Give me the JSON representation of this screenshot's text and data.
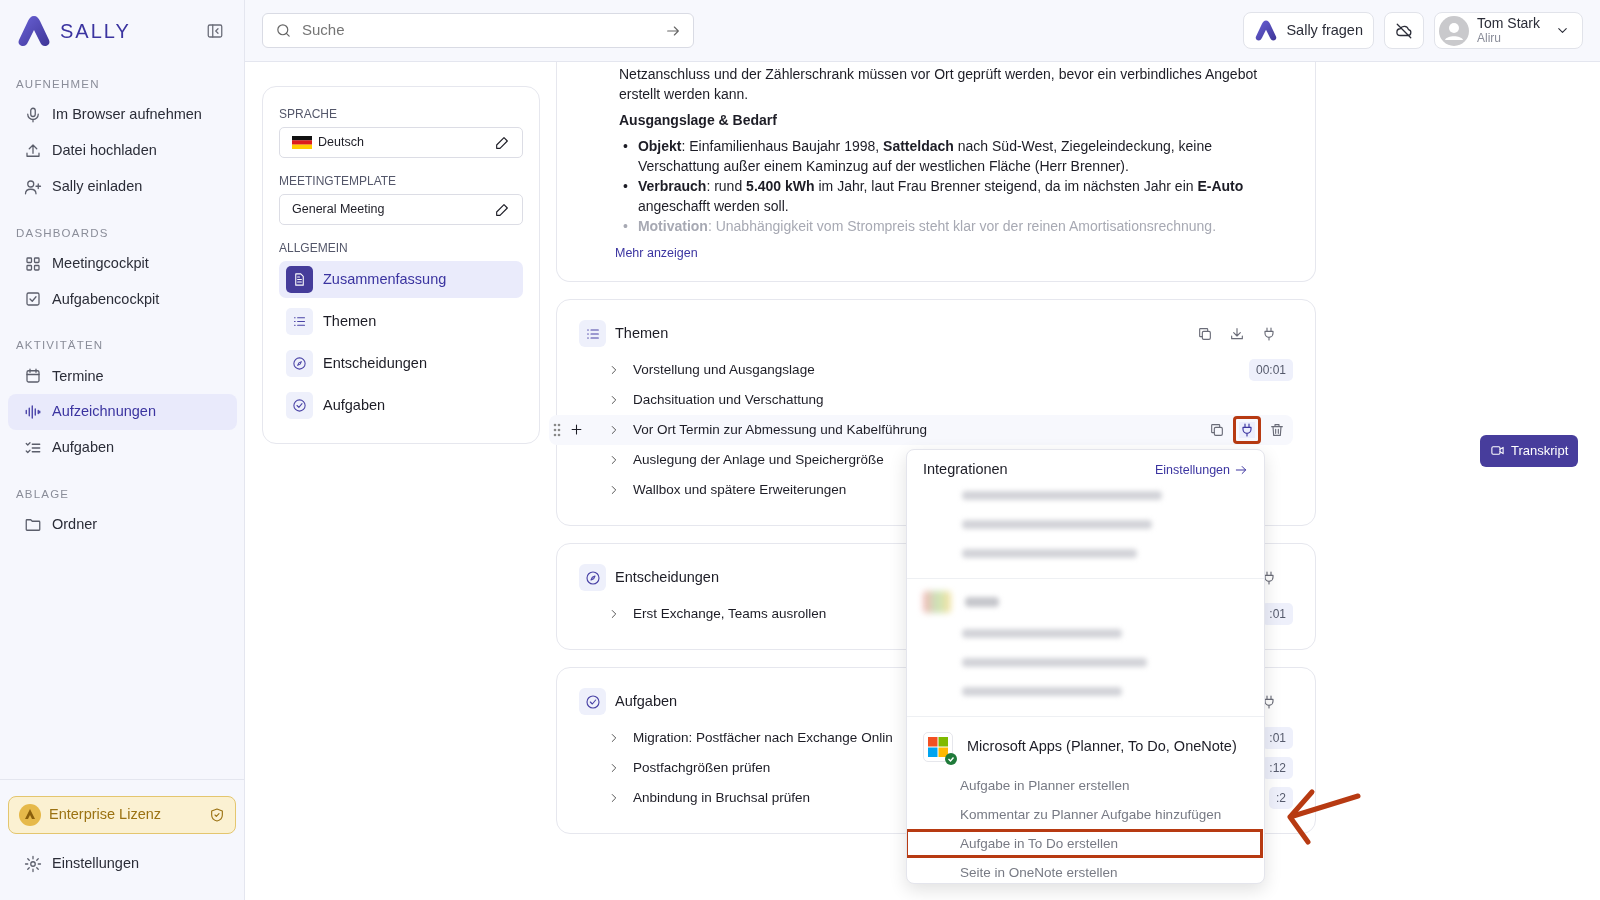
{
  "brand": {
    "name": "SALLY"
  },
  "sidebar": {
    "sections": [
      {
        "title": "AUFNEHMEN",
        "items": [
          {
            "label": "Im Browser aufnehmen",
            "selected": false
          },
          {
            "label": "Datei hochladen",
            "selected": false
          },
          {
            "label": "Sally einladen",
            "selected": false
          }
        ]
      },
      {
        "title": "DASHBOARDS",
        "items": [
          {
            "label": "Meetingcockpit",
            "selected": false
          },
          {
            "label": "Aufgabencockpit",
            "selected": false
          }
        ]
      },
      {
        "title": "AKTIVITÄTEN",
        "items": [
          {
            "label": "Termine",
            "selected": false
          },
          {
            "label": "Aufzeichnungen",
            "selected": true
          },
          {
            "label": "Aufgaben",
            "selected": false
          }
        ]
      },
      {
        "title": "ABLAGE",
        "items": [
          {
            "label": "Ordner",
            "selected": false
          }
        ]
      }
    ],
    "license": {
      "label": "Enterprise Lizenz",
      "verified": true
    },
    "settings": {
      "label": "Einstellungen"
    }
  },
  "search": {
    "placeholder": "Suche"
  },
  "header": {
    "ask_button": "Sally fragen",
    "user": {
      "name": "Tom Stark",
      "org": "Aliru"
    }
  },
  "settings_panel": {
    "language": {
      "label": "SPRACHE",
      "value": "Deutsch"
    },
    "template": {
      "label": "MEETINGTEMPLATE",
      "value": "General Meeting"
    },
    "nav_title": "ALLGEMEIN",
    "nav": [
      {
        "label": "Zusammenfassung",
        "selected": true
      },
      {
        "label": "Themen",
        "selected": false
      },
      {
        "label": "Entscheidungen",
        "selected": false
      },
      {
        "label": "Aufgaben",
        "selected": false
      }
    ]
  },
  "summary": {
    "paragraph": "Netzanschluss und der Zählerschrank müssen vor Ort geprüft werden, bevor ein verbindliches Angebot erstellt werden kann.",
    "heading": "Ausgangslage & Bedarf",
    "bullets": [
      {
        "marker": "•",
        "text": "**Objekt**: Einfamilienhaus Baujahr 1998, **Satteldach** nach Süd-West, Ziegeleindeckung, keine Verschattung außer einem Kaminzug auf der westlichen Fläche (Herr Brenner).",
        "faded": false
      },
      {
        "marker": "•",
        "text": "**Verbrauch**: rund **5.400 kWh** im Jahr, laut Frau Brenner steigend, da im nächsten Jahr ein **E-Auto** angeschafft werden soll.",
        "faded": false
      },
      {
        "marker": "•",
        "text": "**Motivation**: Unabhängigkeit vom Strompreis steht klar vor der reinen Amortisationsrechnung.",
        "faded": true
      }
    ],
    "more_link": "Mehr anzeigen"
  },
  "sections": [
    {
      "title": "Themen",
      "items": [
        {
          "title": "Vorstellung und Ausgangslage",
          "time": "00:01",
          "hovered": false
        },
        {
          "title": "Dachsituation und Verschattung",
          "hovered": false
        },
        {
          "title": "Vor Ort Termin zur Abmessung und Kabelführung",
          "hovered": true,
          "row_actions": [
            {
              "kind": "copy",
              "active": false,
              "annotated": false
            },
            {
              "kind": "plug",
              "active": true,
              "annotated": true
            },
            {
              "kind": "trash",
              "active": false,
              "annotated": false
            }
          ]
        },
        {
          "title": "Auslegung der Anlage und Speichergröße",
          "hovered": false
        },
        {
          "title": "Wallbox und spätere Erweiterungen",
          "hovered": false
        }
      ]
    },
    {
      "title": "Entscheidungen",
      "items": [
        {
          "title": "Erst Exchange, Teams ausrollen",
          "time": ":01",
          "hovered": false
        }
      ]
    },
    {
      "title": "Aufgaben",
      "items": [
        {
          "title": "Migration: Postfächer nach Exchange Onlin",
          "time": ":01",
          "hovered": false
        },
        {
          "title": "Postfachgrößen prüfen",
          "time": ":12",
          "hovered": false
        },
        {
          "title": "Anbindung in Bruchsal prüfen",
          "time": ":2",
          "hovered": false
        }
      ]
    }
  ],
  "transcript_button": "Transkript",
  "dropdown": {
    "title": "Integrationen",
    "settings_link": "Einstellungen",
    "callout_arrow": true,
    "groups": [
      {
        "kind": "redacted",
        "items": [
          {
            "kind": "redacted"
          },
          {
            "kind": "redacted"
          },
          {
            "kind": "redacted"
          }
        ]
      },
      {
        "kind": "redacted_app",
        "items": [
          {
            "kind": "redacted"
          },
          {
            "kind": "redacted"
          },
          {
            "kind": "redacted"
          }
        ]
      },
      {
        "kind": "app",
        "title": "Microsoft Apps (Planner, To Do, OneNote)",
        "connected": true,
        "items": [
          {
            "kind": "action",
            "label": "Aufgabe in Planner erstellen",
            "annotated": false
          },
          {
            "kind": "action",
            "label": "Kommentar zu Planner Aufgabe hinzufügen",
            "annotated": false
          },
          {
            "kind": "action",
            "label": "Aufgabe in To Do erstellen",
            "annotated": true
          },
          {
            "kind": "action",
            "label": "Seite in OneNote erstellen",
            "annotated": false
          }
        ]
      }
    ]
  }
}
